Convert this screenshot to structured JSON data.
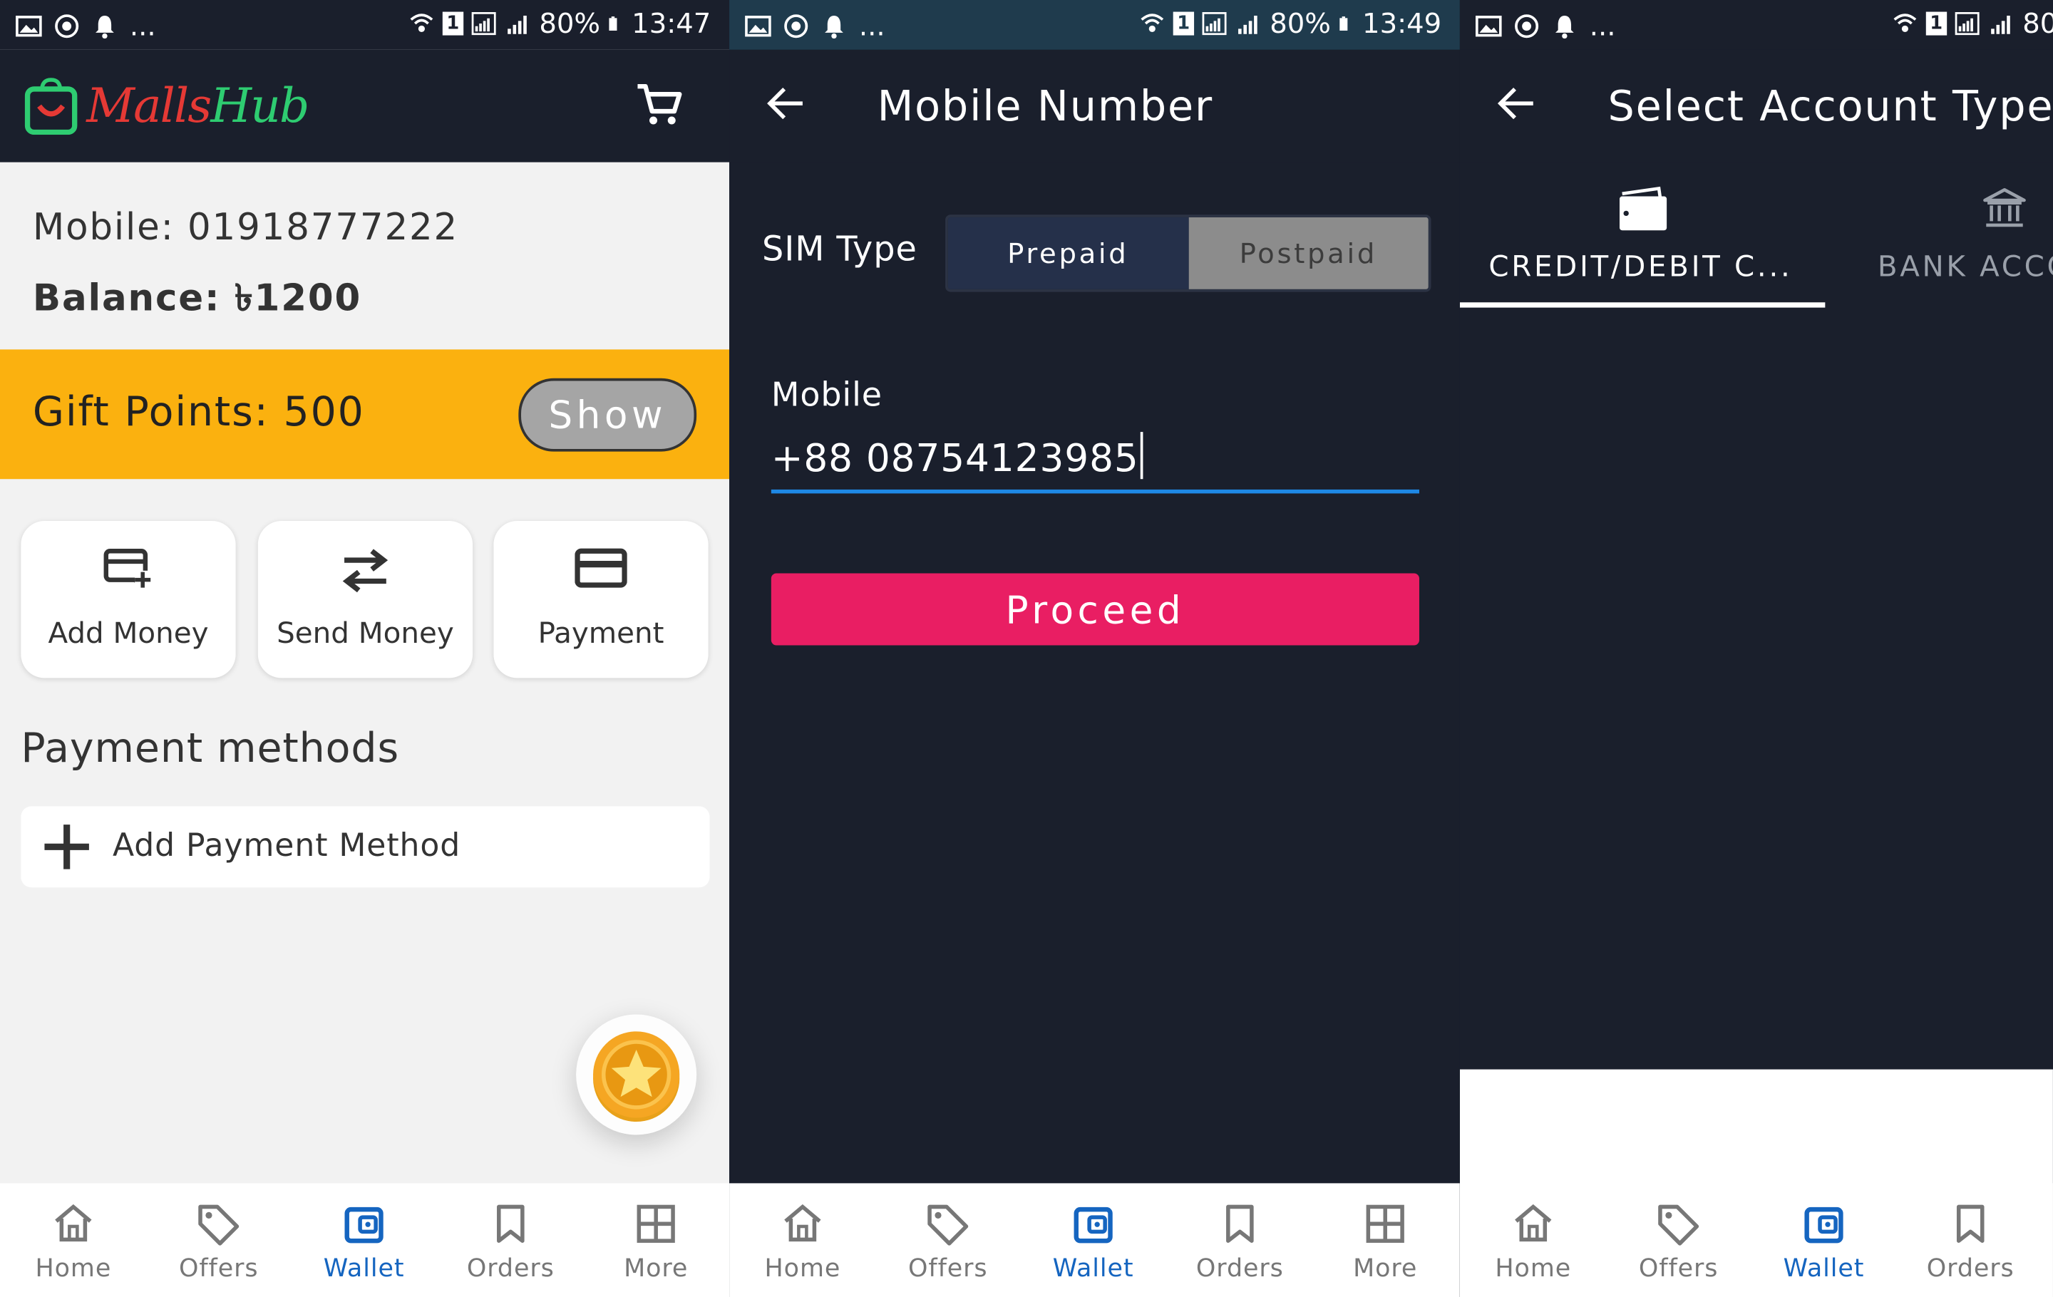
{
  "colors": {
    "dark_bg": "#1a1f2c",
    "accent_yellow": "#fbb10f",
    "proceed_pink": "#e91e63",
    "active_blue": "#1565c0",
    "input_underline": "#1e88e5"
  },
  "nav_items": [
    "Home",
    "Offers",
    "Wallet",
    "Orders",
    "More"
  ],
  "nav_active": "Wallet",
  "panel1": {
    "status": {
      "time": "13:47",
      "battery": "80%",
      "sim": "1",
      "more": "..."
    },
    "logo": {
      "malls": "Malls",
      "hub": "Hub"
    },
    "mobile_label": "Mobile:",
    "mobile_value": "01918777222",
    "balance_label": "Balance:",
    "balance_value": "৳1200",
    "gift_label": "Gift Points:",
    "gift_value": "500",
    "show_label": "Show",
    "actions": [
      "Add Money",
      "Send Money",
      "Payment"
    ],
    "section_title": "Payment methods",
    "add_payment": "Add Payment Method"
  },
  "panel2": {
    "status": {
      "time": "13:49",
      "battery": "80%",
      "sim": "1",
      "more": "..."
    },
    "title": "Mobile Number",
    "sim_type_label": "SIM Type",
    "sim_options": [
      "Prepaid",
      "Postpaid"
    ],
    "sim_selected": "Prepaid",
    "mobile_label": "Mobile",
    "mobile_value": "+88 08754123985",
    "proceed_label": "Proceed"
  },
  "panel3": {
    "status": {
      "battery": "80",
      "sim": "1",
      "more": "..."
    },
    "title": "Select Account Type",
    "tabs": [
      "CREDIT/DEBIT C...",
      "BANK ACCO"
    ],
    "tab_selected": "CREDIT/DEBIT C..."
  }
}
